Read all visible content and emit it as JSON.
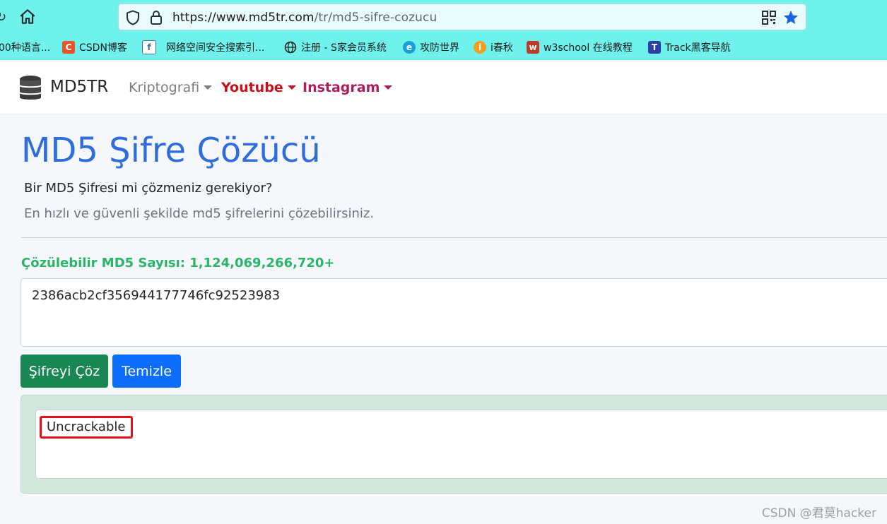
{
  "browser": {
    "url_host": "https://www.md5tr.com",
    "url_path": "/tr/md5-sifre-cozucu",
    "bookmarks": [
      {
        "label": "00种语言...",
        "icon": "bookmark-icon",
        "color": "#6ff2ec"
      },
      {
        "label": "CSDN博客",
        "icon": "csdn-icon",
        "color": "#e8532a"
      },
      {
        "label": "网络空间安全搜索引...",
        "icon": "search-engine-icon",
        "color": "#4a6d8c"
      },
      {
        "label": "注册 - S家会员系统",
        "icon": "globe-icon",
        "color": "#222222"
      },
      {
        "label": "攻防世界",
        "icon": "xctf-icon",
        "color": "#1aa0d8"
      },
      {
        "label": "i春秋",
        "icon": "ichunqiu-icon",
        "color": "#f0a020"
      },
      {
        "label": "w3school 在线教程",
        "icon": "w3school-icon",
        "color": "#c0392b"
      },
      {
        "label": "Track黑客导航",
        "icon": "track-icon",
        "color": "#2d3ea8"
      }
    ]
  },
  "navbar": {
    "brand": "MD5TR",
    "items": [
      {
        "label": "Kriptografi",
        "color": "#7d7d7d"
      },
      {
        "label": "Youtube",
        "color": "#c4111b"
      },
      {
        "label": "Instagram",
        "color": "#ad1f5c"
      }
    ]
  },
  "main": {
    "title": "MD5 Şifre Çözücü",
    "lead": "Bir MD5 Şifresi mi çözmeniz gerekiyor?",
    "subtitle": "En hızlı ve güvenli şekilde md5 şifrelerini çözebilirsiniz.",
    "count_label": "Çözülebilir MD5 Sayısı: 1,124,069,266,720+",
    "hash_value": "2386acb2cf356944177746fc92523983",
    "solve_button": "Şifreyi Çöz",
    "clear_button": "Temizle",
    "result": "Uncrackable"
  },
  "watermark": "CSDN @君莫hacker",
  "colors": {
    "chrome": "#6ff2ec",
    "title": "#2f6ddc",
    "count": "#2ab56a",
    "solve": "#198754",
    "clear": "#0d6efd",
    "result_well": "#d1e7dd",
    "highlight": "#e3111b"
  }
}
